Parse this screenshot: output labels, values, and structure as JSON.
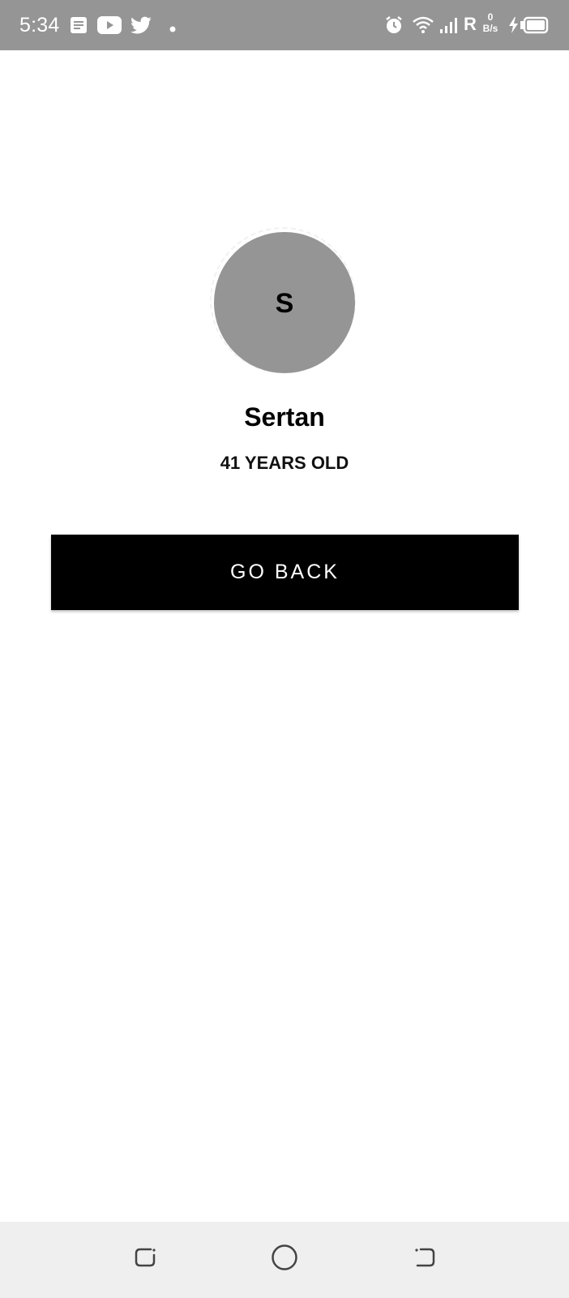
{
  "status_bar": {
    "time": "5:34",
    "net_speed_value": "0",
    "net_speed_unit": "B/s",
    "roaming": "R",
    "background_color": "#959595",
    "icons": [
      "notes-icon",
      "youtube-icon",
      "twitter-icon",
      "notification-dot-icon",
      "alarm-icon",
      "wifi-icon",
      "signal-icon",
      "charging-icon",
      "battery-icon"
    ]
  },
  "profile": {
    "avatar_initial": "S",
    "avatar_color": "#959595",
    "name": "Sertan",
    "age_text": "41 YEARS OLD"
  },
  "actions": {
    "go_back_label": "GO BACK",
    "button_color": "#000000"
  },
  "nav_bar": {
    "buttons": [
      "recents-icon",
      "home-icon",
      "back-icon"
    ],
    "background_color": "#efefef"
  }
}
